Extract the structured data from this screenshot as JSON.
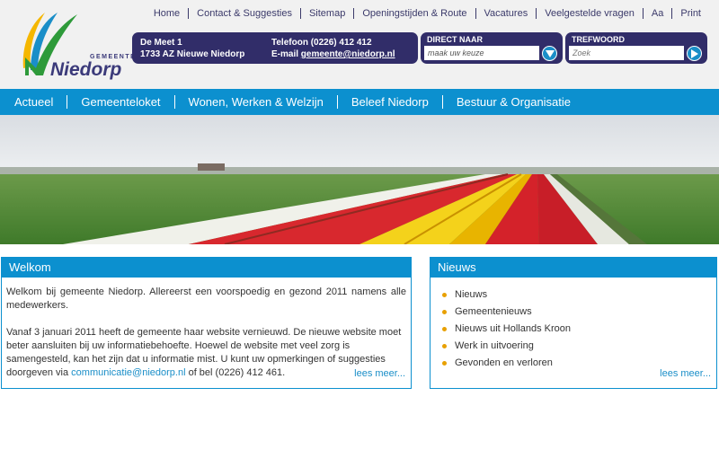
{
  "logo": {
    "small_text": "GEMEENTE",
    "name": "Niedorp"
  },
  "toplinks": [
    "Home",
    "Contact & Suggesties",
    "Sitemap",
    "Openingstijden & Route",
    "Vacatures",
    "Veelgestelde vragen",
    "Aa",
    "Print"
  ],
  "contact": {
    "address1": "De Meet 1",
    "address2": "1733 AZ Nieuwe Niedorp",
    "phone": "Telefoon (0226) 412 412",
    "email_label": "E-mail ",
    "email": "gemeente@niedorp.nl"
  },
  "direct": {
    "label": "DIRECT NAAR",
    "placeholder": "maak uw keuze"
  },
  "search": {
    "label": "TREFWOORD",
    "placeholder": "Zoek"
  },
  "nav": [
    "Actueel",
    "Gemeenteloket",
    "Wonen, Werken & Welzijn",
    "Beleef Niedorp",
    "Bestuur & Organisatie"
  ],
  "welkom": {
    "title": "Welkom",
    "p1": "Welkom bij gemeente Niedorp. Allereerst een voorspoedig en gezond 2011 namens alle medewerkers.",
    "p2_a": "Vanaf 3 januari 2011 heeft de gemeente haar website vernieuwd. De nieuwe website moet beter aansluiten bij uw informatiebehoefte. Hoewel de website met veel zorg is samengesteld, kan het zijn dat u informatie mist. U kunt uw opmerkingen of suggesties doorgeven via ",
    "p2_link": "communicatie@niedorp.nl",
    "p2_b": " of bel (0226)  412 461.",
    "more": "lees meer..."
  },
  "nieuws": {
    "title": "Nieuws",
    "items": [
      "Nieuws",
      "Gemeentenieuws",
      "Nieuws uit Hollands Kroon",
      "Werk in uitvoering",
      "Gevonden en verloren"
    ],
    "more": "lees meer..."
  },
  "colors": {
    "brand_dark": "#312d69",
    "brand_blue": "#0c90cf",
    "bullet": "#e8a000"
  }
}
